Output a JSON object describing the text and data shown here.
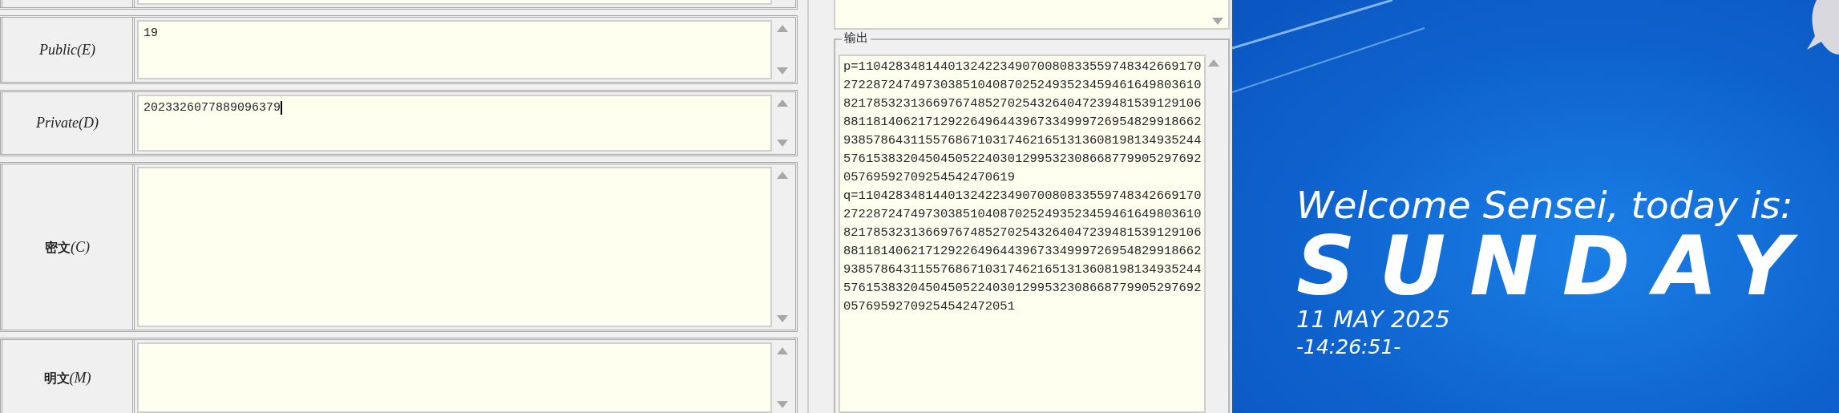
{
  "form_rows": [
    {
      "label": "Public(E)",
      "value": "19",
      "focused": false
    },
    {
      "label": "Private(D)",
      "value": "2023326077889096379",
      "focused": true
    },
    {
      "label": "**密文**(C)",
      "value": "",
      "focused": false
    },
    {
      "label": "**明文**(M)",
      "value": "",
      "focused": false
    }
  ],
  "output": {
    "legend": "输出",
    "lines": [
      "p=110428348144013242234907008083355974834266917027228724749730385104087025249352345946164980361082178532313669767485270254326404723948153912910688118140621712922649644396733499972695482991866293857864311557686710317462165131360819813493524457615383204504505224030129953230866877990529769205769592709254542470619",
      "q=110428348144013242234907008083355974834266917027228724749730385104087025249352345946164980361082178532313669767485270254326404723948153912910688118140621712922649644396733499972695482991866293857864311557686710317462165131360819813493524457615383204504505224030129953230866877990529769205769592709254542472051"
    ]
  },
  "wallpaper": {
    "greeting": "Welcome Sensei, today is:",
    "day": "SUNDAY",
    "date": "11 MAY 2025",
    "time": "-14:26:51-"
  }
}
